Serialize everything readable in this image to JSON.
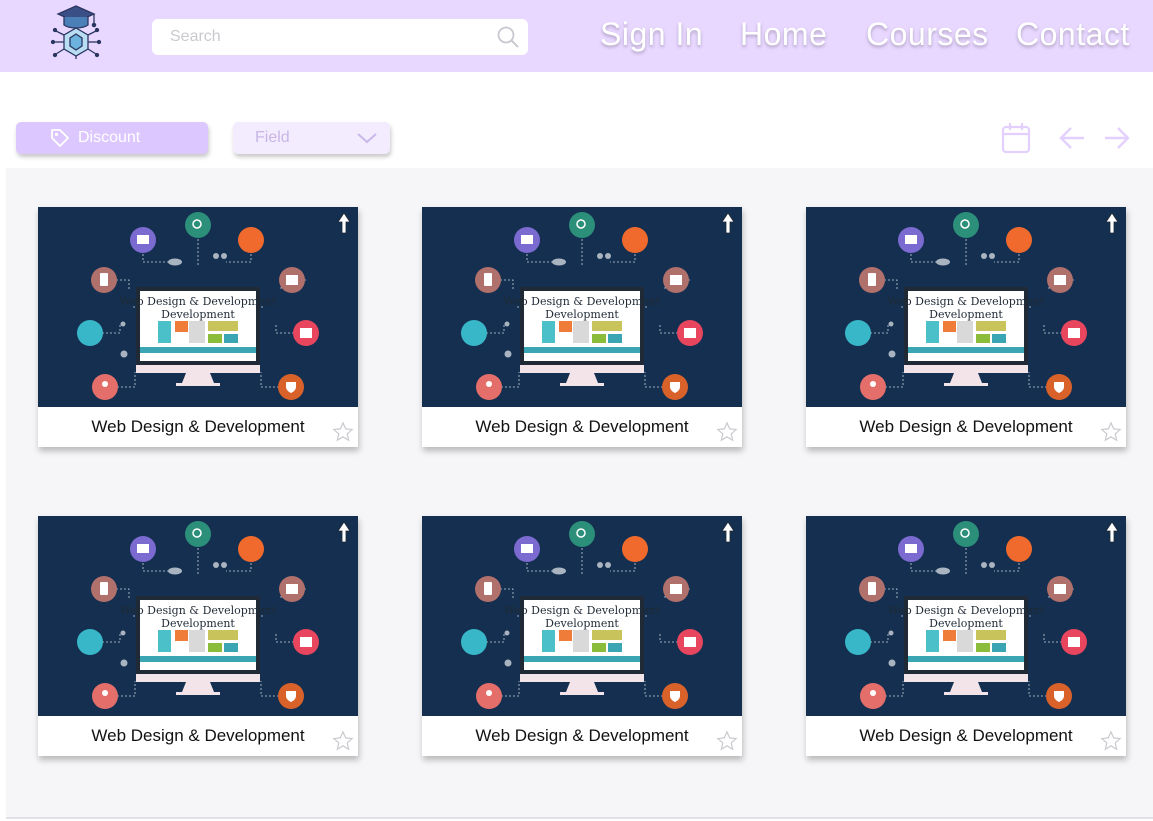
{
  "header": {
    "search": {
      "placeholder": "Search",
      "value": ""
    },
    "nav": {
      "sign_in": "Sign In",
      "home": "Home",
      "courses": "Courses",
      "contact": "Contact"
    }
  },
  "toolbar": {
    "discount_label": "Discount",
    "field_label": "Field"
  },
  "icons": {
    "logo": "graduation-cap-circuit-logo",
    "search": "search-icon",
    "discount": "tag-icon",
    "field": "chevron-down-icon",
    "calendar": "calendar-icon",
    "prev": "arrow-left-icon",
    "next": "arrow-right-icon",
    "card_badge": "arrow-up-icon",
    "favorite": "star-icon"
  },
  "colors": {
    "header_bg": "#e8d7ff",
    "accent": "#dcc7ff",
    "icon_tint": "#e3d0ff",
    "thumb_bg": "#142f4f"
  },
  "thumbnail_caption": "Web Design & Development",
  "courses": [
    {
      "title": "Web Design & Development"
    },
    {
      "title": "Web Design & Development"
    },
    {
      "title": "Web Design & Development"
    },
    {
      "title": "Web Design & Development"
    },
    {
      "title": "Web Design & Development"
    },
    {
      "title": "Web Design & Development"
    }
  ]
}
